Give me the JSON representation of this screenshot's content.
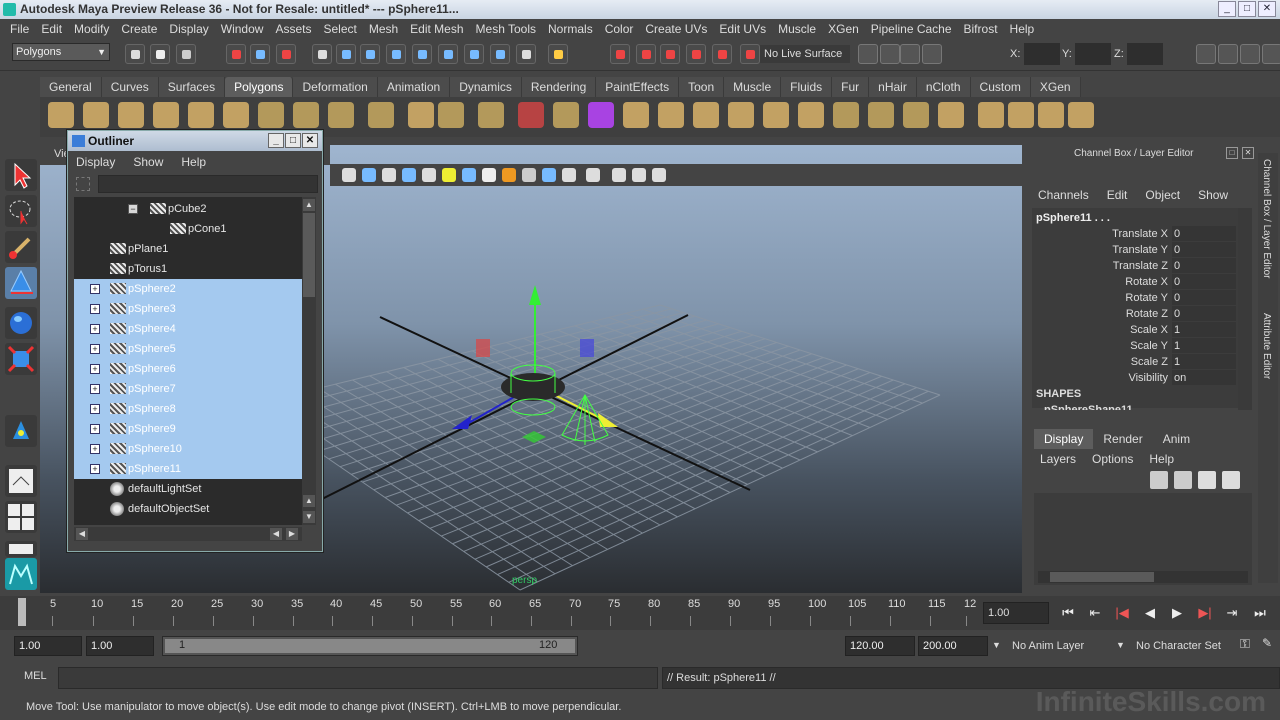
{
  "window": {
    "title": "Autodesk Maya Preview Release 36 - Not for Resale: untitled*   ---   pSphere11..."
  },
  "menubar": [
    "File",
    "Edit",
    "Modify",
    "Create",
    "Display",
    "Window",
    "Assets",
    "Select",
    "Mesh",
    "Edit Mesh",
    "Mesh Tools",
    "Normals",
    "Color",
    "Create UVs",
    "Edit UVs",
    "Muscle",
    "XGen",
    "Pipeline Cache",
    "Bifrost",
    "Help"
  ],
  "status": {
    "mode": "Polygons",
    "live_surface": "No Live Surface",
    "x_label": "X:",
    "y_label": "Y:",
    "z_label": "Z:"
  },
  "shelf_tabs": [
    "General",
    "Curves",
    "Surfaces",
    "Polygons",
    "Deformation",
    "Animation",
    "Dynamics",
    "Rendering",
    "PaintEffects",
    "Toon",
    "Muscle",
    "Fluids",
    "Fur",
    "nHair",
    "nCloth",
    "Custom",
    "XGen"
  ],
  "shelf_active": "Polygons",
  "viewport": {
    "menu_fragment": "Vie",
    "grid_label": "persp"
  },
  "outliner": {
    "title": "Outliner",
    "menu": [
      "Display",
      "Show",
      "Help"
    ],
    "rows": [
      {
        "label": "pCube2",
        "selected": false,
        "expander": "⊟"
      },
      {
        "label": "pCone1",
        "selected": false,
        "expander": ""
      },
      {
        "label": "pPlane1",
        "selected": false,
        "expander": ""
      },
      {
        "label": "pTorus1",
        "selected": false,
        "expander": ""
      },
      {
        "label": "pSphere2",
        "selected": true,
        "expander": "⊞"
      },
      {
        "label": "pSphere3",
        "selected": true,
        "expander": "⊞"
      },
      {
        "label": "pSphere4",
        "selected": true,
        "expander": "⊞"
      },
      {
        "label": "pSphere5",
        "selected": true,
        "expander": "⊞"
      },
      {
        "label": "pSphere6",
        "selected": true,
        "expander": "⊞"
      },
      {
        "label": "pSphere7",
        "selected": true,
        "expander": "⊞"
      },
      {
        "label": "pSphere8",
        "selected": true,
        "expander": "⊞"
      },
      {
        "label": "pSphere9",
        "selected": true,
        "expander": "⊞"
      },
      {
        "label": "pSphere10",
        "selected": true,
        "expander": "⊞"
      },
      {
        "label": "pSphere11",
        "selected": true,
        "expander": "⊞"
      },
      {
        "label": "defaultLightSet",
        "selected": false,
        "expander": ""
      },
      {
        "label": "defaultObjectSet",
        "selected": false,
        "expander": ""
      }
    ]
  },
  "channel_box": {
    "header": "Channel Box / Layer Editor",
    "menu": [
      "Channels",
      "Edit",
      "Object",
      "Show"
    ],
    "object": "pSphere11 . . .",
    "channels": [
      {
        "name": "Translate X",
        "value": "0"
      },
      {
        "name": "Translate Y",
        "value": "0"
      },
      {
        "name": "Translate Z",
        "value": "0"
      },
      {
        "name": "Rotate X",
        "value": "0"
      },
      {
        "name": "Rotate Y",
        "value": "0"
      },
      {
        "name": "Rotate Z",
        "value": "0"
      },
      {
        "name": "Scale X",
        "value": "1"
      },
      {
        "name": "Scale Y",
        "value": "1"
      },
      {
        "name": "Scale Z",
        "value": "1"
      },
      {
        "name": "Visibility",
        "value": "on"
      }
    ],
    "shapes_label": "SHAPES",
    "shape_name": "pSphereShape11",
    "side_tabs": [
      "Channel Box / Layer Editor",
      "Attribute Editor"
    ]
  },
  "layer_editor": {
    "tabs": [
      "Display",
      "Render",
      "Anim"
    ],
    "active_tab": "Display",
    "menu": [
      "Layers",
      "Options",
      "Help"
    ]
  },
  "timeline": {
    "ticks": [
      "1",
      "5",
      "10",
      "15",
      "20",
      "25",
      "30",
      "35",
      "40",
      "45",
      "50",
      "55",
      "60",
      "65",
      "70",
      "75",
      "80",
      "85",
      "90",
      "95",
      "100",
      "105",
      "110",
      "115",
      "12"
    ],
    "current_frame": "1.00"
  },
  "range": {
    "start": "1.00",
    "start2": "1.00",
    "slider_start": "1",
    "slider_end": "120",
    "end": "120.00",
    "end2": "200.00",
    "anim_layer": "No Anim Layer",
    "character_set": "No Character Set"
  },
  "command": {
    "lang": "MEL",
    "result": "// Result: pSphere11 //"
  },
  "help_line": "Move Tool: Use manipulator to move object(s). Use edit mode to change pivot (INSERT).  Ctrl+LMB to move perpendicular.",
  "watermark": "InfiniteSkills.com"
}
